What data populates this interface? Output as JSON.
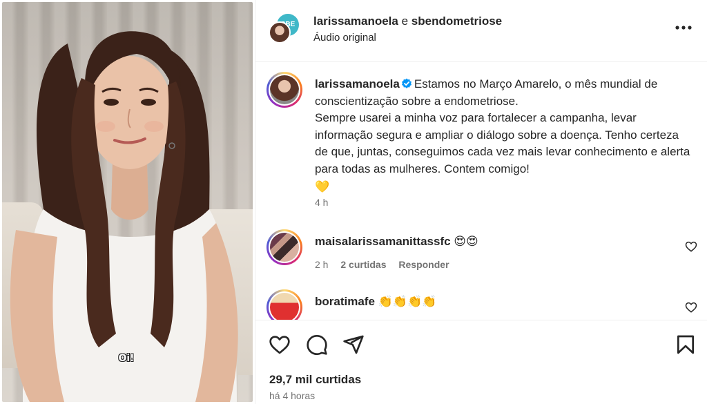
{
  "media": {
    "overlay_caption": "Oi!"
  },
  "header": {
    "user1": "larissamanoela",
    "connector": "e",
    "user2": "sbendometriose",
    "audio": "Áudio original",
    "collab_badge_text": "SBE"
  },
  "caption": {
    "username": "larissamanoela",
    "line1": "Estamos no Março Amarelo, o mês mundial de conscientização sobre a endometriose.",
    "line2": "Sempre usarei a minha voz para fortalecer a campanha, levar informação segura e ampliar o diálogo sobre a doença. Tenho certeza de que, juntas, conseguimos cada vez mais levar conhecimento e alerta para todas as mulheres. Contem comigo!",
    "emoji": "💛",
    "time": "4 h"
  },
  "comments": [
    {
      "username": "maisalarissamanittassfc",
      "text": "😍😍",
      "time": "2 h",
      "likes": "2 curtidas",
      "reply": "Responder"
    },
    {
      "username": "boratimafe",
      "text": "👏👏👏👏"
    }
  ],
  "footer": {
    "likes": "29,7 mil curtidas",
    "time_ago": "há 4 horas"
  },
  "icons": {
    "more": "more-horizontal-icon",
    "verified": "verified-badge-icon",
    "like": "heart-icon",
    "comment": "comment-icon",
    "share": "send-icon",
    "save": "bookmark-icon"
  },
  "colors": {
    "verified": "#0095f6",
    "muted_text": "#737373",
    "primary_text": "#262626"
  }
}
